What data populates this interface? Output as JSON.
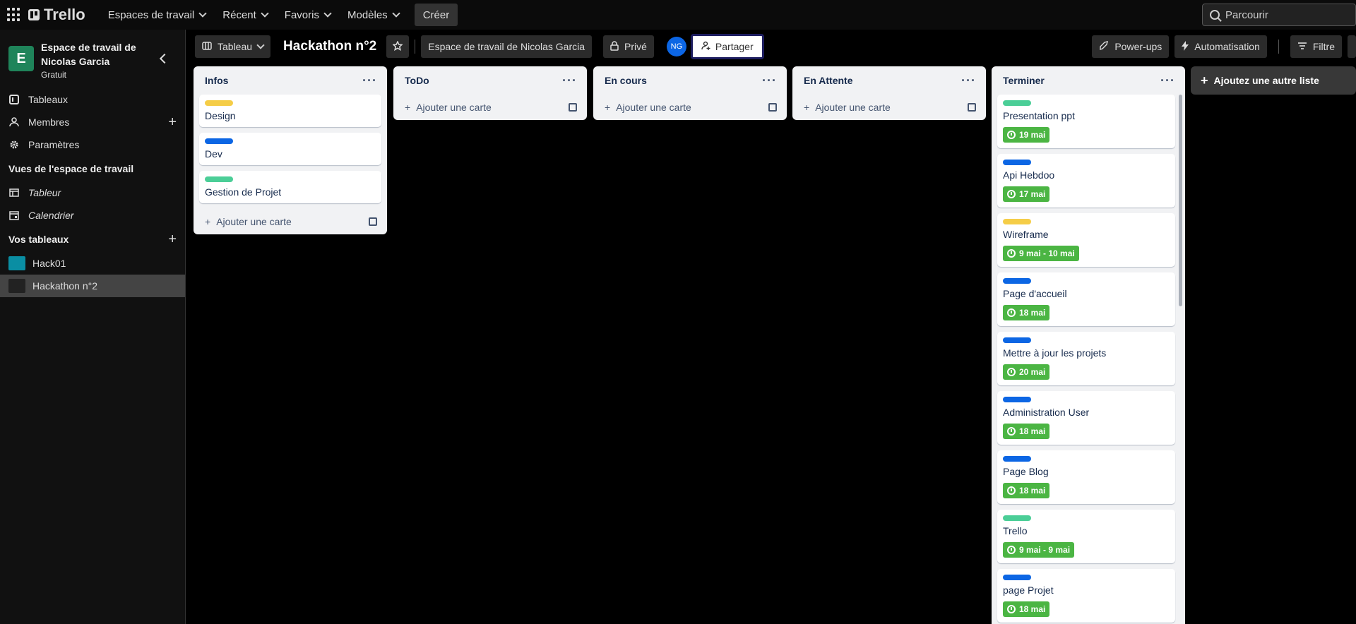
{
  "topbar": {
    "logo": "Trello",
    "nav": [
      "Espaces de travail",
      "Récent",
      "Favoris",
      "Modèles"
    ],
    "create": "Créer",
    "search_placeholder": "Parcourir"
  },
  "sidebar": {
    "workspace_initial": "E",
    "workspace_name": "Espace de travail de Nicolas Garcia",
    "workspace_plan": "Gratuit",
    "items": [
      "Tableaux",
      "Membres",
      "Paramètres"
    ],
    "views_title": "Vues de l'espace de travail",
    "views": [
      "Tableur",
      "Calendrier"
    ],
    "boards_title": "Vos tableaux",
    "boards": [
      {
        "name": "Hack01",
        "color": "#0a8ea3"
      },
      {
        "name": "Hackathon n°2",
        "color": "#222222"
      }
    ]
  },
  "board": {
    "view_button": "Tableau",
    "title": "Hackathon n°2",
    "workspace_button": "Espace de travail de Nicolas Garcia",
    "visibility": "Privé",
    "avatar": "NG",
    "share": "Partager",
    "powerups": "Power-ups",
    "automation": "Automatisation",
    "filter": "Filtre",
    "add_list": "Ajoutez une autre liste",
    "add_card": "Ajouter une carte"
  },
  "lists": [
    {
      "title": "Infos",
      "cards": [
        {
          "label_color": "#f5cd47",
          "title": "Design"
        },
        {
          "label_color": "#0c66e4",
          "title": "Dev"
        },
        {
          "label_color": "#4bce97",
          "title": "Gestion de Projet"
        }
      ]
    },
    {
      "title": "ToDo",
      "cards": []
    },
    {
      "title": "En cours",
      "cards": []
    },
    {
      "title": "En Attente",
      "cards": []
    },
    {
      "title": "Terminer",
      "cards": [
        {
          "label_color": "#4bce97",
          "title": "Presentation ppt",
          "due": "19 mai"
        },
        {
          "label_color": "#0c66e4",
          "title": "Api Hebdoo",
          "due": "17 mai"
        },
        {
          "label_color": "#f5cd47",
          "title": "Wireframe",
          "due": "9 mai - 10 mai"
        },
        {
          "label_color": "#0c66e4",
          "title": "Page d'accueil",
          "due": "18 mai"
        },
        {
          "label_color": "#0c66e4",
          "title": "Mettre à jour les projets",
          "due": "20 mai"
        },
        {
          "label_color": "#0c66e4",
          "title": "Administration User",
          "due": "18 mai"
        },
        {
          "label_color": "#0c66e4",
          "title": "Page Blog",
          "due": "18 mai"
        },
        {
          "label_color": "#4bce97",
          "title": "Trello",
          "due": "9 mai - 9 mai"
        },
        {
          "label_color": "#0c66e4",
          "title": "page Projet",
          "due": "18 mai"
        }
      ]
    }
  ]
}
